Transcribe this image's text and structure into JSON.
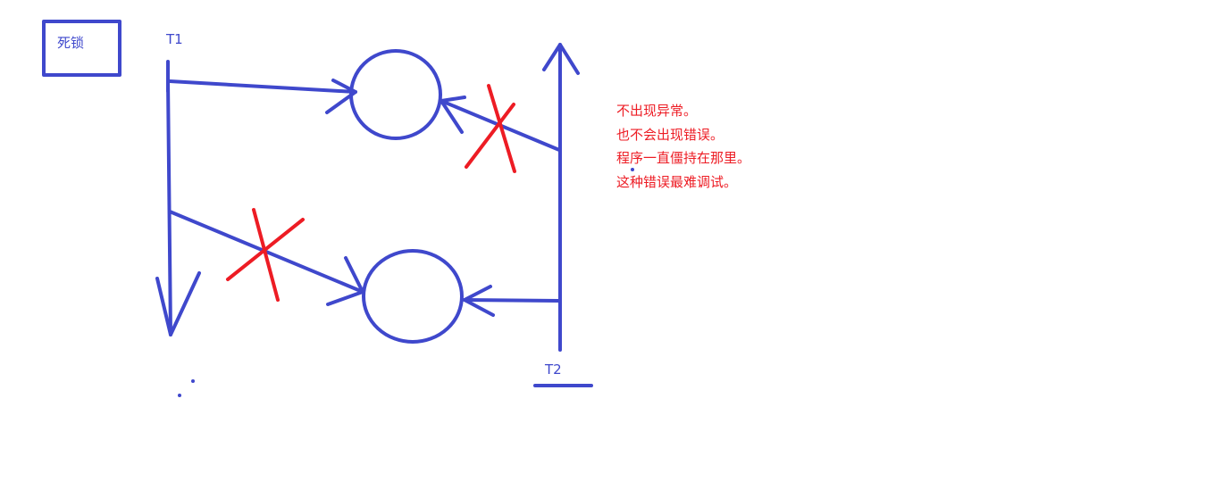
{
  "title_box": {
    "text": "死锁"
  },
  "threads": [
    {
      "id": "t1",
      "label": "T1"
    },
    {
      "id": "t2",
      "label": "T2"
    }
  ],
  "notes": [
    "不出现异常。",
    "也不会出现错误。",
    "程序一直僵持在那里。",
    "这种错误最难调试。"
  ],
  "colors": {
    "ink": "#3f48cc",
    "cross": "#ed1c24"
  }
}
